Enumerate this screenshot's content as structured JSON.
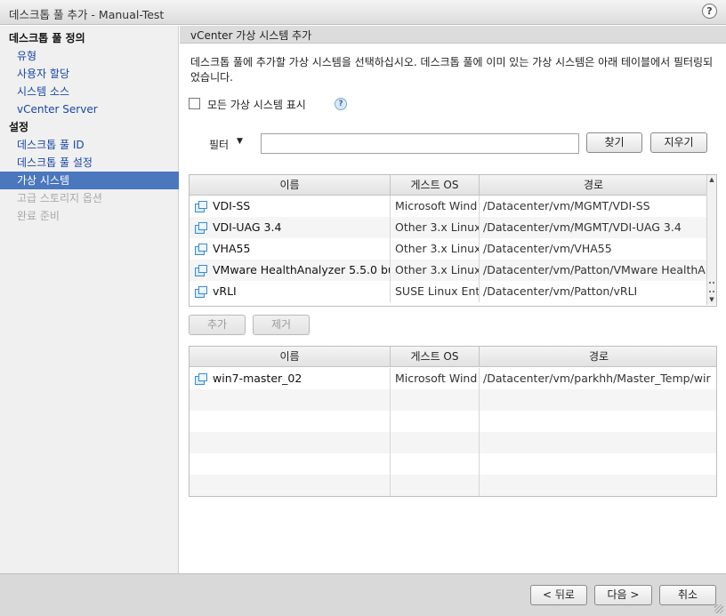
{
  "window": {
    "title": "데스크톱 풀 추가 - Manual-Test",
    "help_glyph": "?"
  },
  "sidebar": {
    "items": [
      {
        "label": "데스크톱 풀 정의",
        "kind": "header"
      },
      {
        "label": "유형",
        "kind": "link"
      },
      {
        "label": "사용자 할당",
        "kind": "link"
      },
      {
        "label": "시스템 소스",
        "kind": "link"
      },
      {
        "label": "vCenter Server",
        "kind": "link"
      },
      {
        "label": "설정",
        "kind": "header"
      },
      {
        "label": "데스크톱 풀 ID",
        "kind": "link"
      },
      {
        "label": "데스크톱 풀 설정",
        "kind": "link"
      },
      {
        "label": "가상 시스템",
        "kind": "selected"
      },
      {
        "label": "고급 스토리지 옵션",
        "kind": "disabled"
      },
      {
        "label": "완료 준비",
        "kind": "disabled"
      }
    ]
  },
  "main": {
    "header": "vCenter 가상 시스템 추가",
    "description": "데스크톱 풀에 추가할 가상 시스템을 선택하십시오. 데스크톱 풀에 이미 있는 가상 시스템은 아래 테이블에서 필터링되었습니다.",
    "show_all_label": "모든 가상 시스템 표시",
    "help_glyph": "?",
    "filter": {
      "label": "필터",
      "caret": "▼",
      "value": "",
      "find_label": "찾기",
      "clear_label": "지우기"
    },
    "available": {
      "columns": [
        "이름",
        "게스트 OS",
        "경로"
      ],
      "rows": [
        {
          "name": "VDI-SS",
          "os": "Microsoft Wind",
          "path": "/Datacenter/vm/MGMT/VDI-SS"
        },
        {
          "name": "VDI-UAG 3.4",
          "os": "Other 3.x Linux",
          "path": "/Datacenter/vm/MGMT/VDI-UAG 3.4"
        },
        {
          "name": "VHA55",
          "os": "Other 3.x Linux",
          "path": "/Datacenter/vm/VHA55"
        },
        {
          "name": "VMware HealthAnalyzer 5.5.0 bu",
          "os": "Other 3.x Linux",
          "path": "/Datacenter/vm/Patton/VMware HealthA"
        },
        {
          "name": "vRLI",
          "os": "SUSE Linux Ent",
          "path": "/Datacenter/vm/Patton/vRLI"
        }
      ]
    },
    "add_label": "추가",
    "remove_label": "제거",
    "selected": {
      "columns": [
        "이름",
        "게스트 OS",
        "경로"
      ],
      "rows": [
        {
          "name": "win7-master_02",
          "os": "Microsoft Wind",
          "path": "/Datacenter/vm/parkhh/Master_Temp/wir"
        }
      ]
    }
  },
  "footer": {
    "back_label": "< 뒤로",
    "next_label": "다음 >",
    "cancel_label": "취소"
  }
}
